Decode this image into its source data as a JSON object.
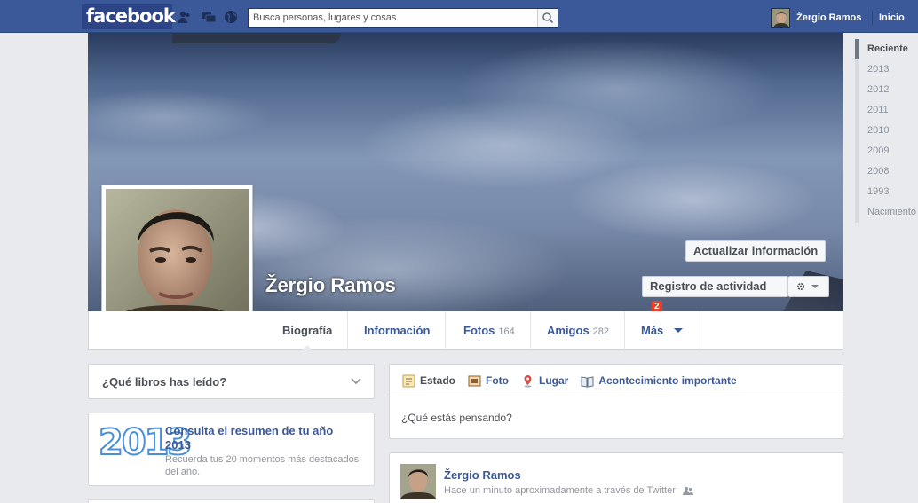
{
  "topbar": {
    "logo": "facebook",
    "search_placeholder": "Busca personas, lugares y cosas",
    "user_name": "Žergio Ramos",
    "home_label": "Inicio",
    "colors": {
      "bar": "#3b5998",
      "logo_bg": "#2d4486"
    }
  },
  "cover": {
    "name": "Žergio Ramos",
    "update_button": "Actualizar información",
    "activity_log_button": "Registro de actividad",
    "activity_badge": "2"
  },
  "tabs": [
    {
      "label": "Biografía",
      "count": ""
    },
    {
      "label": "Información",
      "count": ""
    },
    {
      "label": "Fotos",
      "count": "164"
    },
    {
      "label": "Amigos",
      "count": "282"
    },
    {
      "label": "Más",
      "count": ""
    }
  ],
  "timeline_nav": [
    "Reciente",
    "2013",
    "2012",
    "2011",
    "2010",
    "2009",
    "2008",
    "1993",
    "Nacimiento"
  ],
  "books_card": {
    "question": "¿Qué libros has leído?"
  },
  "year_in_review": {
    "year": "2013",
    "title": "Consulta el resumen de tu año 2013",
    "subtitle": "Recuerda tus 20 momentos más destacados del año."
  },
  "composer": {
    "actions": [
      "Estado",
      "Foto",
      "Lugar",
      "Acontecimiento importante"
    ],
    "placeholder": "¿Qué estás pensando?"
  },
  "post": {
    "author": "Žergio Ramos",
    "meta": "Hace un minuto aproximadamente a través de Twitter"
  }
}
